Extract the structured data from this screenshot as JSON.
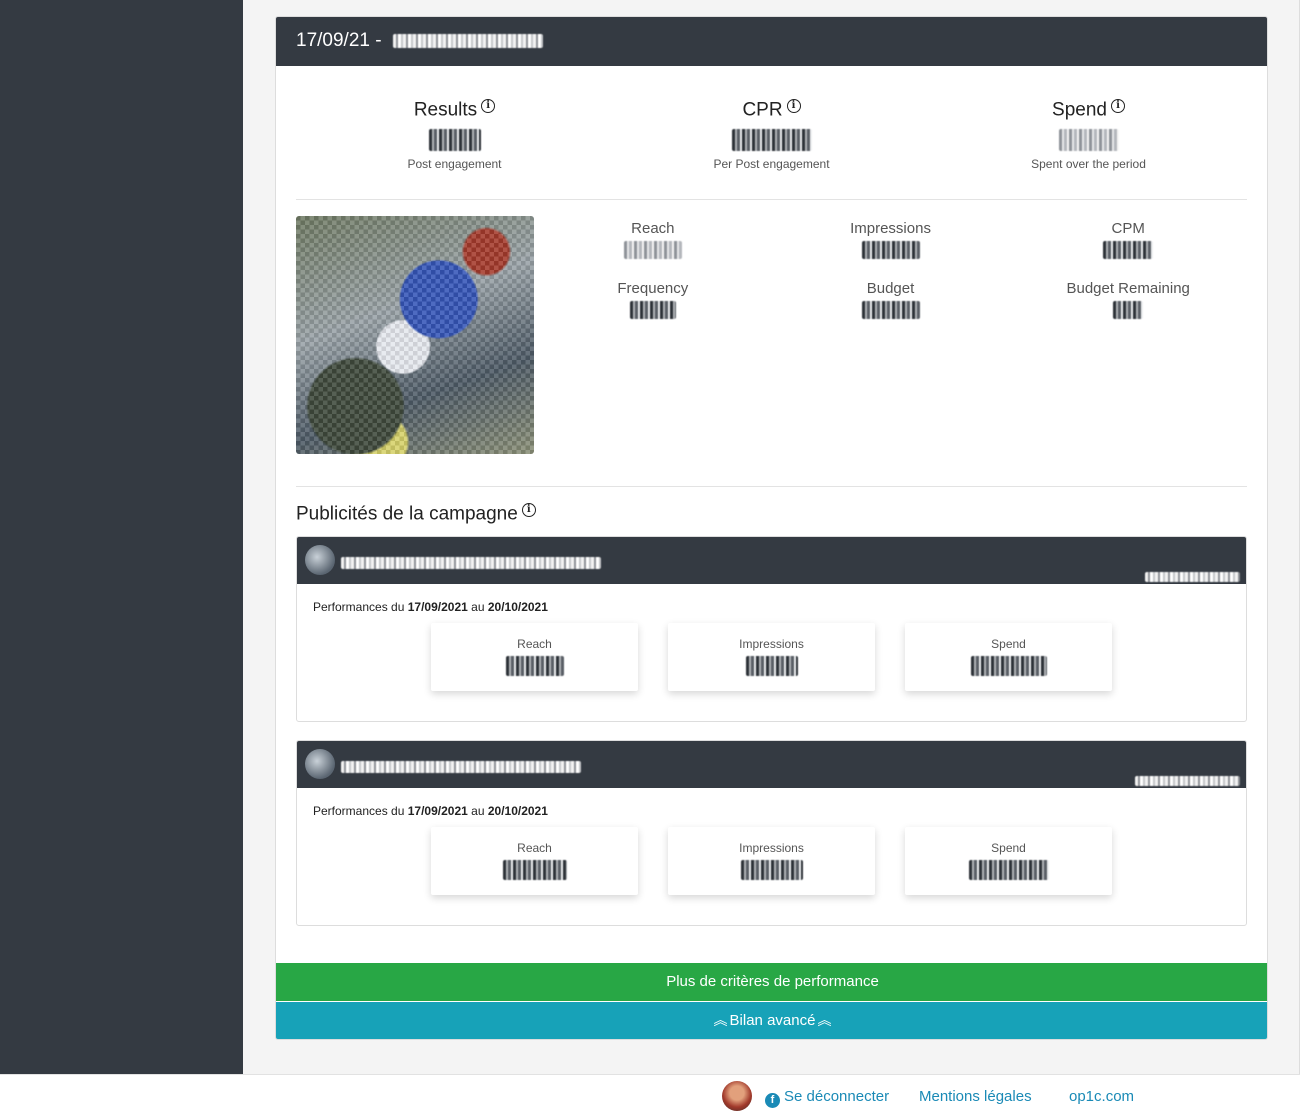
{
  "campaign": {
    "header_date": "17/09/21 -"
  },
  "kpis": [
    {
      "title": "Results",
      "subtitle": "Post engagement"
    },
    {
      "title": "CPR",
      "subtitle": "Per Post engagement"
    },
    {
      "title": "Spend",
      "subtitle": "Spent over the period"
    }
  ],
  "metrics": [
    {
      "label": "Reach"
    },
    {
      "label": "Impressions"
    },
    {
      "label": "CPM"
    },
    {
      "label": "Frequency"
    },
    {
      "label": "Budget"
    },
    {
      "label": "Budget Remaining"
    }
  ],
  "ads_section": {
    "title": "Publicités de la campagne"
  },
  "ads": [
    {
      "perf_prefix": "Performances du",
      "start": "17/09/2021",
      "between": "au",
      "end": "20/10/2021",
      "boxes": [
        "Reach",
        "Impressions",
        "Spend"
      ]
    },
    {
      "perf_prefix": "Performances du",
      "start": "17/09/2021",
      "between": "au",
      "end": "20/10/2021",
      "boxes": [
        "Reach",
        "Impressions",
        "Spend"
      ]
    }
  ],
  "buttons": {
    "more_criteria": "Plus de critères de performance",
    "advanced_report": "Bilan avancé"
  },
  "footer": {
    "logout": "Se déconnecter",
    "legal": "Mentions légales",
    "site": "op1c.com"
  },
  "colors": {
    "sidebar": "#343a42",
    "header": "#343a42",
    "green_button": "#28a745",
    "teal_button": "#17a2b8",
    "link": "#1a8ab6"
  },
  "icons": [
    "info-icon",
    "facebook-icon",
    "double-chevron-up-icon"
  ]
}
